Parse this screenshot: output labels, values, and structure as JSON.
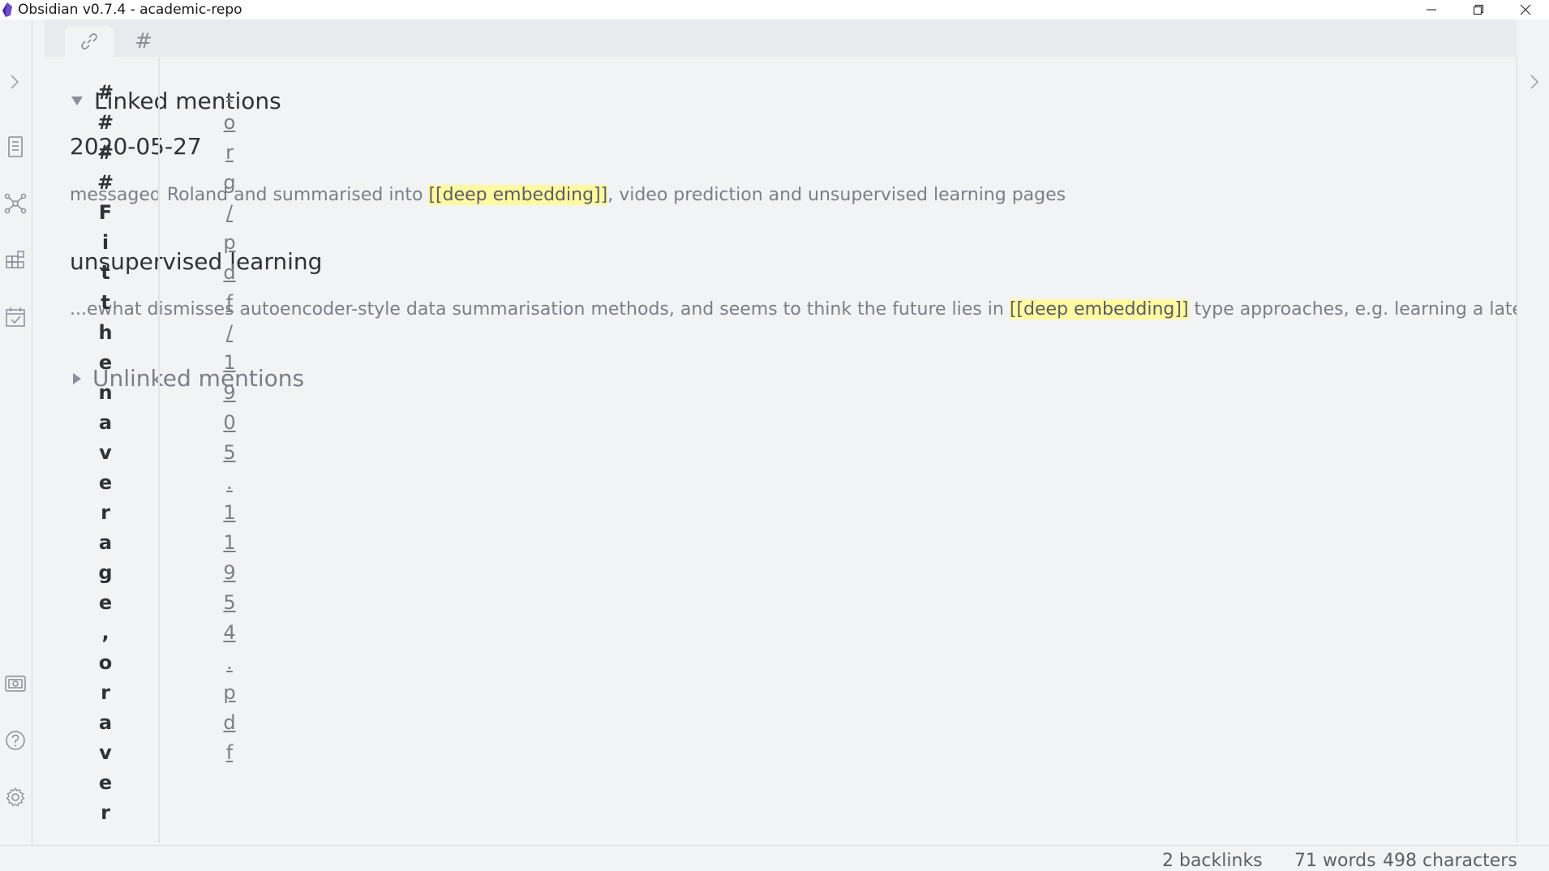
{
  "window": {
    "title": "Obsidian v0.7.4 - academic-repo"
  },
  "pane": {
    "tabs": [
      {
        "name": "link-icon",
        "active": true
      },
      {
        "name": "tag",
        "label": "#",
        "active": false
      }
    ]
  },
  "backlinks": {
    "linked_header": "Linked mentions",
    "unlinked_header": "Unlinked mentions",
    "results": [
      {
        "title": "2020-05-27",
        "snippet_before": "messaged Roland and summarised into ",
        "snippet_link": "[[deep embedding]]",
        "snippet_after": ", video prediction and unsupervised learning pages"
      },
      {
        "title": "unsupervised learning",
        "snippet_before": "...ewhat dismisses autoencoder-style data summarisation methods, and seems to think the future lies in ",
        "snippet_link": "[[deep embedding]]",
        "snippet_after": " type approaches, e.g. learning a late"
      }
    ]
  },
  "overflow_text": {
    "col_a": "####Fitthenaverage,oraver",
    "col_b": ".org/pdf/1905.11954.pdf"
  },
  "status": {
    "backlinks": "2 backlinks",
    "words": "71 words",
    "characters": "498 characters"
  },
  "colors": {
    "highlight": "#fff9a0",
    "background": "#f2f3f5"
  }
}
